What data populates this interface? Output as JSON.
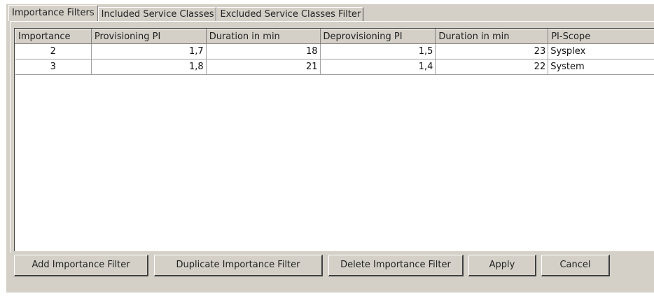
{
  "tabs": [
    {
      "label": "Importance Filters"
    },
    {
      "label": "Included Service Classes"
    },
    {
      "label": "Excluded Service Classes Filter"
    }
  ],
  "table": {
    "columns": [
      "Importance",
      "Provisioning PI",
      "Duration in min",
      "Deprovisioning PI",
      "Duration in min",
      "PI-Scope"
    ],
    "rows": [
      [
        "2",
        "1,7",
        "18",
        "1,5",
        "23",
        "Sysplex"
      ],
      [
        "3",
        "1,8",
        "21",
        "1,4",
        "22",
        "System"
      ]
    ]
  },
  "buttons": {
    "add": "Add Importance Filter",
    "duplicate": "Duplicate Importance Filter",
    "delete": "Delete Importance Filter",
    "apply": "Apply",
    "cancel": "Cancel"
  }
}
